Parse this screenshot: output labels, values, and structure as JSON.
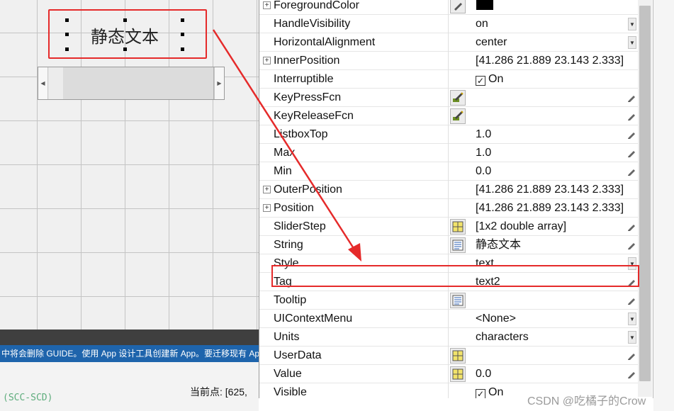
{
  "canvas": {
    "static_text": "静态文本",
    "info_bar_text": "中将会删除 GUIDE。使用 App 设计工具创建新 App。要迁移现有 Ap",
    "code_fragment": "(SCC-SCD)",
    "current_point_label": "当前点:",
    "current_point_value": "[625,"
  },
  "inspector": {
    "properties": [
      {
        "name": "ForegroundColor",
        "value": "",
        "expandable": true,
        "icon": "color-picker-icon",
        "control": "none"
      },
      {
        "name": "HandleVisibility",
        "value": "on",
        "expandable": false,
        "icon": "",
        "control": "dropdown"
      },
      {
        "name": "HorizontalAlignment",
        "value": "center",
        "expandable": false,
        "icon": "",
        "control": "dropdown"
      },
      {
        "name": "InnerPosition",
        "value": "[41.286 21.889 23.143 2.333]",
        "expandable": true,
        "icon": "",
        "control": "none"
      },
      {
        "name": "Interruptible",
        "value": "On",
        "expandable": false,
        "icon": "",
        "control": "checkbox"
      },
      {
        "name": "KeyPressFcn",
        "value": "",
        "expandable": false,
        "icon": "callback-editor-icon",
        "control": "edit"
      },
      {
        "name": "KeyReleaseFcn",
        "value": "",
        "expandable": false,
        "icon": "callback-editor-icon",
        "control": "edit"
      },
      {
        "name": "ListboxTop",
        "value": "1.0",
        "expandable": false,
        "icon": "",
        "control": "edit"
      },
      {
        "name": "Max",
        "value": "1.0",
        "expandable": false,
        "icon": "",
        "control": "edit"
      },
      {
        "name": "Min",
        "value": "0.0",
        "expandable": false,
        "icon": "",
        "control": "edit"
      },
      {
        "name": "OuterPosition",
        "value": "[41.286 21.889 23.143 2.333]",
        "expandable": true,
        "icon": "",
        "control": "none"
      },
      {
        "name": "Position",
        "value": "[41.286 21.889 23.143 2.333]",
        "expandable": true,
        "icon": "",
        "control": "none"
      },
      {
        "name": "SliderStep",
        "value": "[1x2  double array]",
        "expandable": false,
        "icon": "array-editor-icon",
        "control": "edit"
      },
      {
        "name": "String",
        "value": "静态文本",
        "expandable": false,
        "icon": "text-editor-icon",
        "control": "edit"
      },
      {
        "name": "Style",
        "value": "text",
        "expandable": false,
        "icon": "",
        "control": "dropdown"
      },
      {
        "name": "Tag",
        "value": "text2",
        "expandable": false,
        "icon": "",
        "control": "edit"
      },
      {
        "name": "Tooltip",
        "value": "",
        "expandable": false,
        "icon": "text-editor-icon",
        "control": "edit"
      },
      {
        "name": "UIContextMenu",
        "value": "<None>",
        "expandable": false,
        "icon": "",
        "control": "dropdown"
      },
      {
        "name": "Units",
        "value": "characters",
        "expandable": false,
        "icon": "",
        "control": "dropdown"
      },
      {
        "name": "UserData",
        "value": "",
        "expandable": false,
        "icon": "array-editor-icon",
        "control": "edit"
      },
      {
        "name": "Value",
        "value": "0.0",
        "expandable": false,
        "icon": "array-editor-icon",
        "control": "edit"
      },
      {
        "name": "Visible",
        "value": "On",
        "expandable": false,
        "icon": "",
        "control": "checkbox"
      }
    ]
  },
  "watermark": "CSDN @吃橘子的Crow",
  "colors": {
    "highlight": "#e52a2a",
    "info_bar": "#1e64ac"
  }
}
